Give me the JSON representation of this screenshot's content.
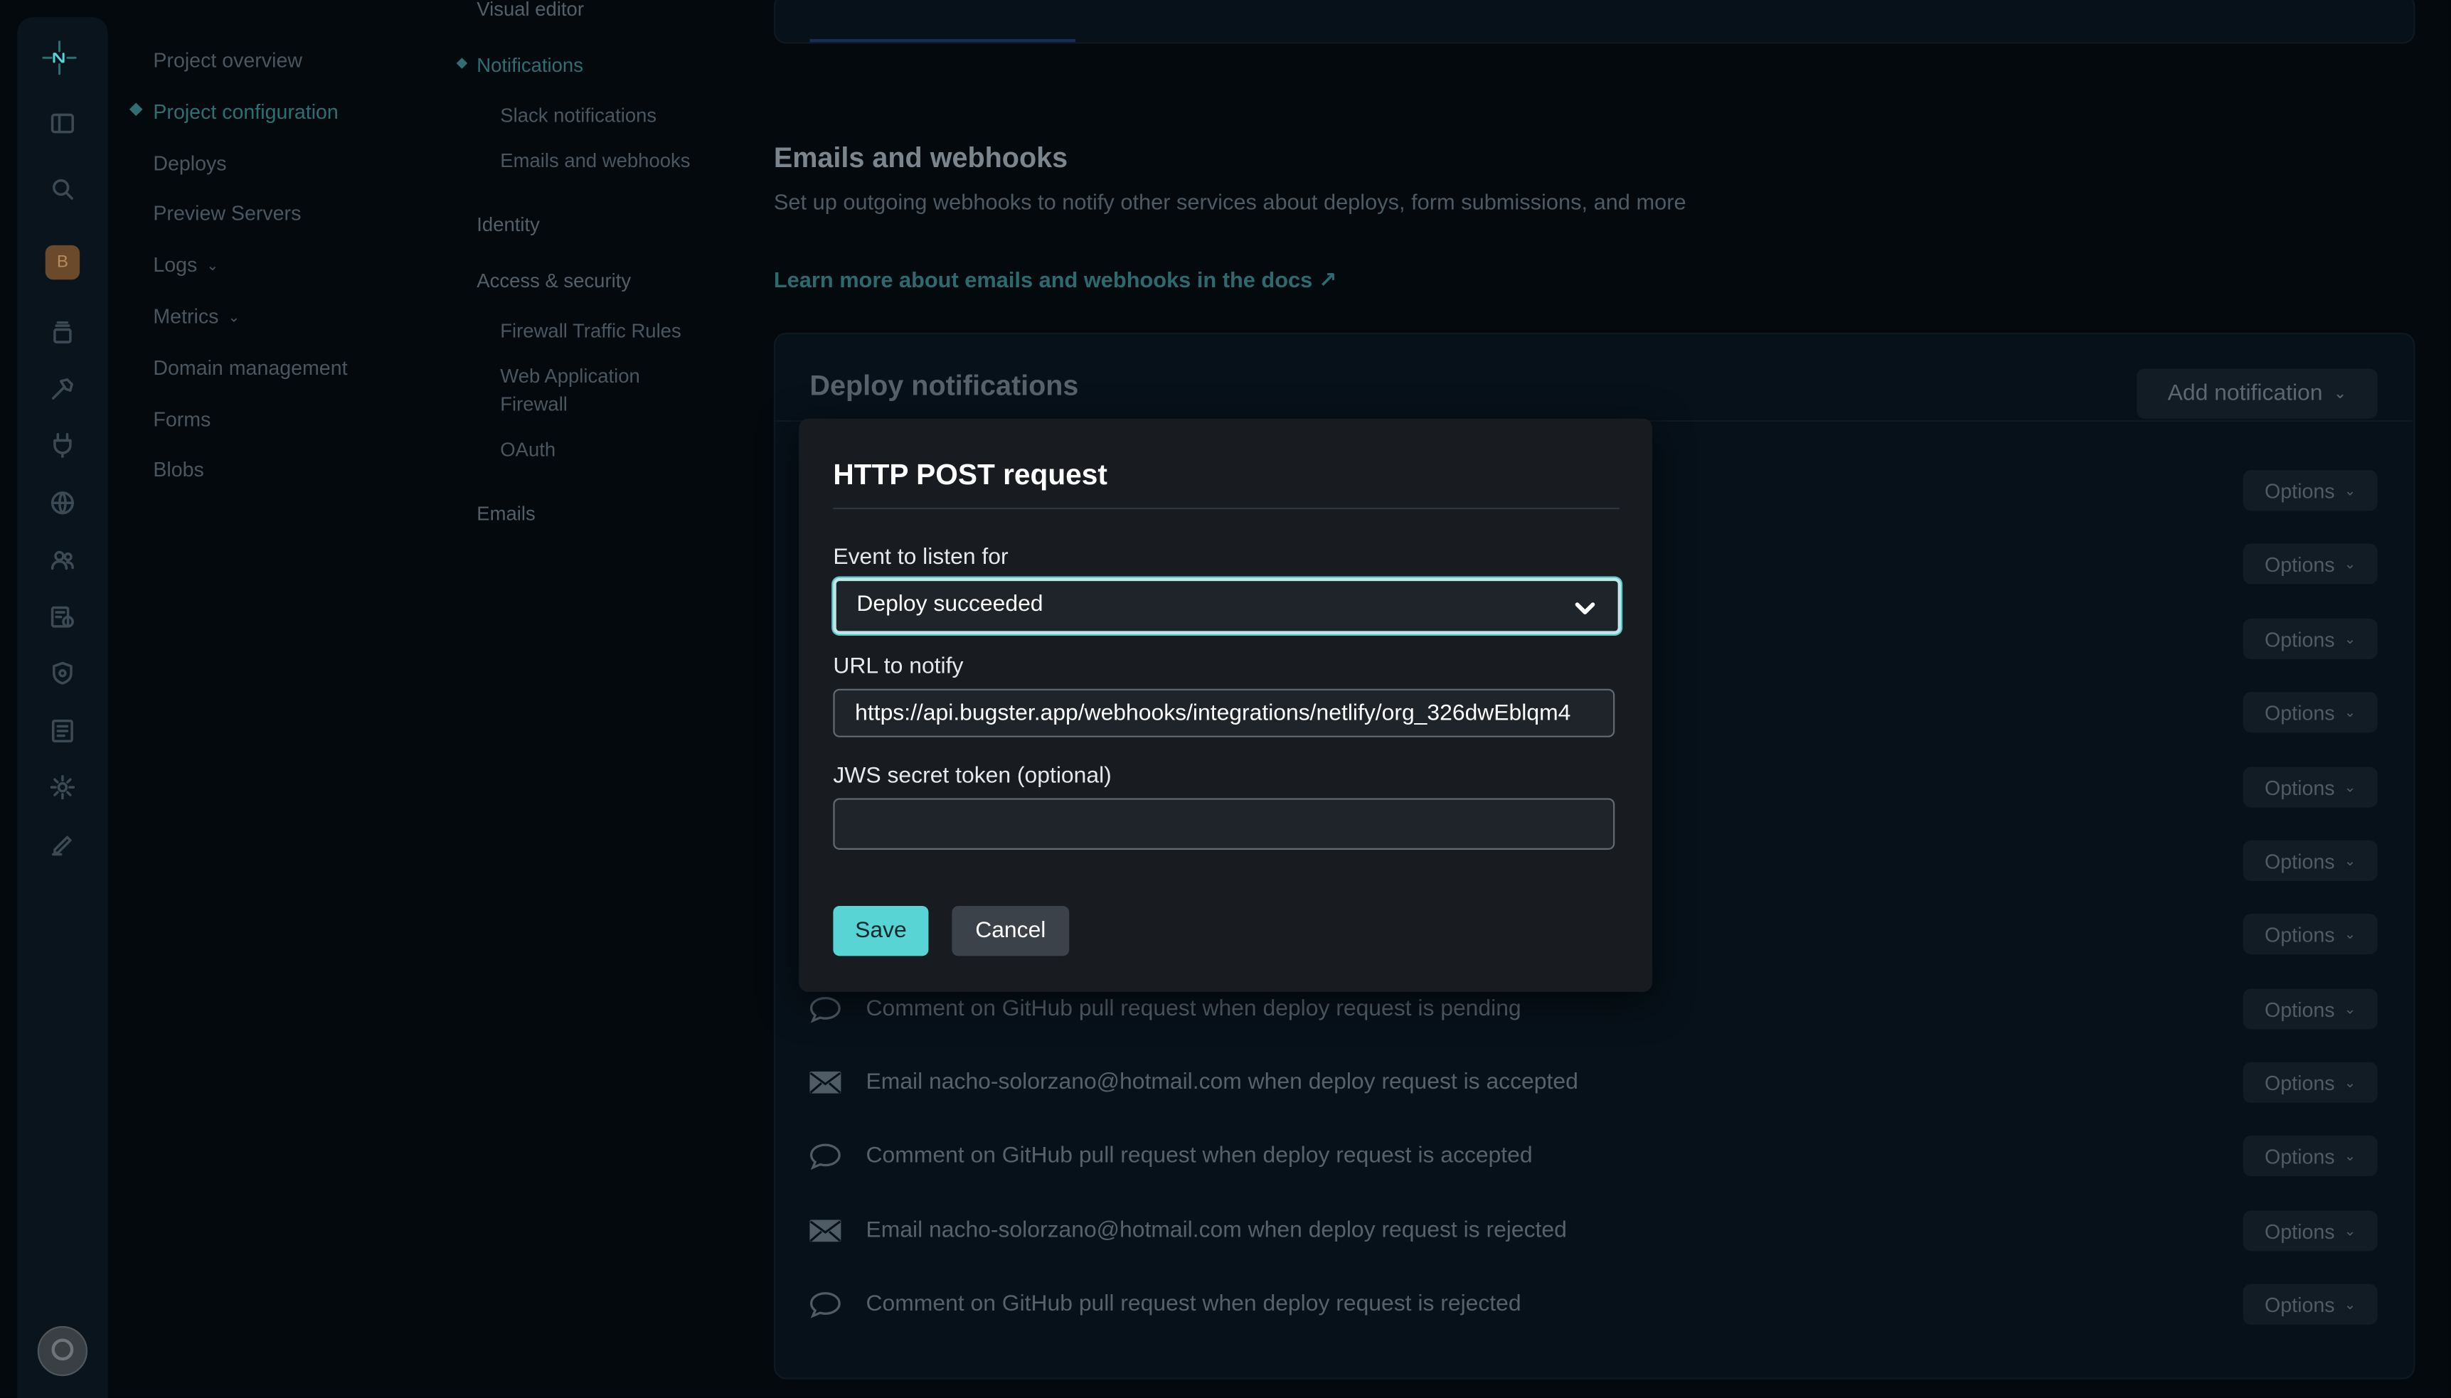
{
  "rail": {
    "team_initial": "B",
    "icons": [
      "netlify-logo-icon",
      "sidebar-toggle-icon",
      "search-icon",
      "layers-icon",
      "build-hammer-icon",
      "plug-icon",
      "globe-icon",
      "team-icon",
      "certificate-icon",
      "shield-icon",
      "docs-icon",
      "gear-icon",
      "edit-icon"
    ]
  },
  "nav": {
    "items": [
      {
        "label": "Project overview",
        "active": false
      },
      {
        "label": "Project configuration",
        "active": true
      },
      {
        "label": "Deploys",
        "active": false
      },
      {
        "label": "Preview Servers",
        "active": false
      },
      {
        "label": "Logs",
        "active": false
      },
      {
        "label": "Metrics",
        "active": false
      },
      {
        "label": "Domain management",
        "active": false
      },
      {
        "label": "Forms",
        "active": false
      },
      {
        "label": "Blobs",
        "active": false
      }
    ]
  },
  "subnav": {
    "visual_editor": "Visual editor",
    "notifications": "Notifications",
    "slack": "Slack notifications",
    "emails_webhooks": "Emails and webhooks",
    "identity": "Identity",
    "access_security": "Access & security",
    "firewall": "Firewall Traffic Rules",
    "waf_line1": "Web Application",
    "waf_line2": "Firewall",
    "oauth": "OAuth",
    "emails": "Emails"
  },
  "main": {
    "section_title": "Emails and webhooks",
    "section_desc": "Set up outgoing webhooks to notify other services about deploys, form submissions, and more",
    "section_link": "Learn more about emails and webhooks in the docs",
    "deploy_title": "Deploy notifications",
    "add_notification": "Add notification",
    "options_label": "Options",
    "rows": [
      {
        "icon": "comment-icon",
        "text": "Comment on GitHub pull request when deploy request is pending"
      },
      {
        "icon": "envelope-icon",
        "text": "Email nacho-solorzano@hotmail.com when deploy request is accepted"
      },
      {
        "icon": "comment-icon",
        "text": "Comment on GitHub pull request when deploy request is accepted"
      },
      {
        "icon": "envelope-icon",
        "text": "Email nacho-solorzano@hotmail.com when deploy request is rejected"
      },
      {
        "icon": "comment-icon",
        "text": "Comment on GitHub pull request when deploy request is rejected"
      }
    ]
  },
  "modal": {
    "title": "HTTP POST request",
    "event_label": "Event to listen for",
    "event_value": "Deploy succeeded",
    "url_label": "URL to notify",
    "url_value": "https://api.bugster.app/webhooks/integrations/netlify/org_326dwEblqm4",
    "jws_label": "JWS secret token (optional)",
    "jws_value": "",
    "save": "Save",
    "cancel": "Cancel"
  },
  "colors": {
    "accent": "#58d4d4",
    "background": "#04090e",
    "modal_bg": "#181c21"
  }
}
